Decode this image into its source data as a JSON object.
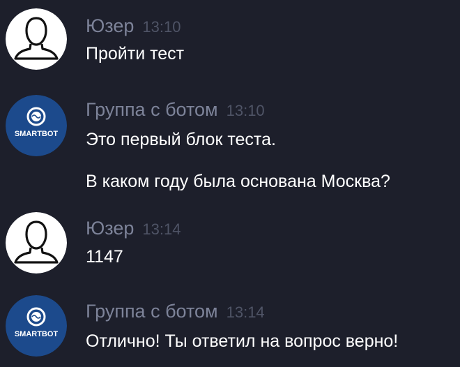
{
  "messages": [
    {
      "author": "Юзер",
      "time": "13:10",
      "avatar": "user-silhouette-icon",
      "lines": [
        "Пройти тест"
      ]
    },
    {
      "author": "Группа с ботом",
      "time": "13:10",
      "avatar": "smartbot-logo",
      "lines": [
        "Это первый блок теста.",
        "В каком году была основана Москва?"
      ]
    },
    {
      "author": "Юзер",
      "time": "13:14",
      "avatar": "user-silhouette-icon",
      "lines": [
        "1147"
      ]
    },
    {
      "author": "Группа с ботом",
      "time": "13:14",
      "avatar": "smartbot-logo",
      "lines": [
        "Отлично! Ты ответил на вопрос верно!"
      ]
    }
  ],
  "logo_text": "SMARTBOT",
  "colors": {
    "background": "#1d1f2b",
    "author_name": "#7d8399",
    "timestamp": "#4f5466",
    "message_text": "#ffffff",
    "user_avatar_bg": "#ffffff",
    "bot_avatar_bg": "#1c4a8c"
  }
}
